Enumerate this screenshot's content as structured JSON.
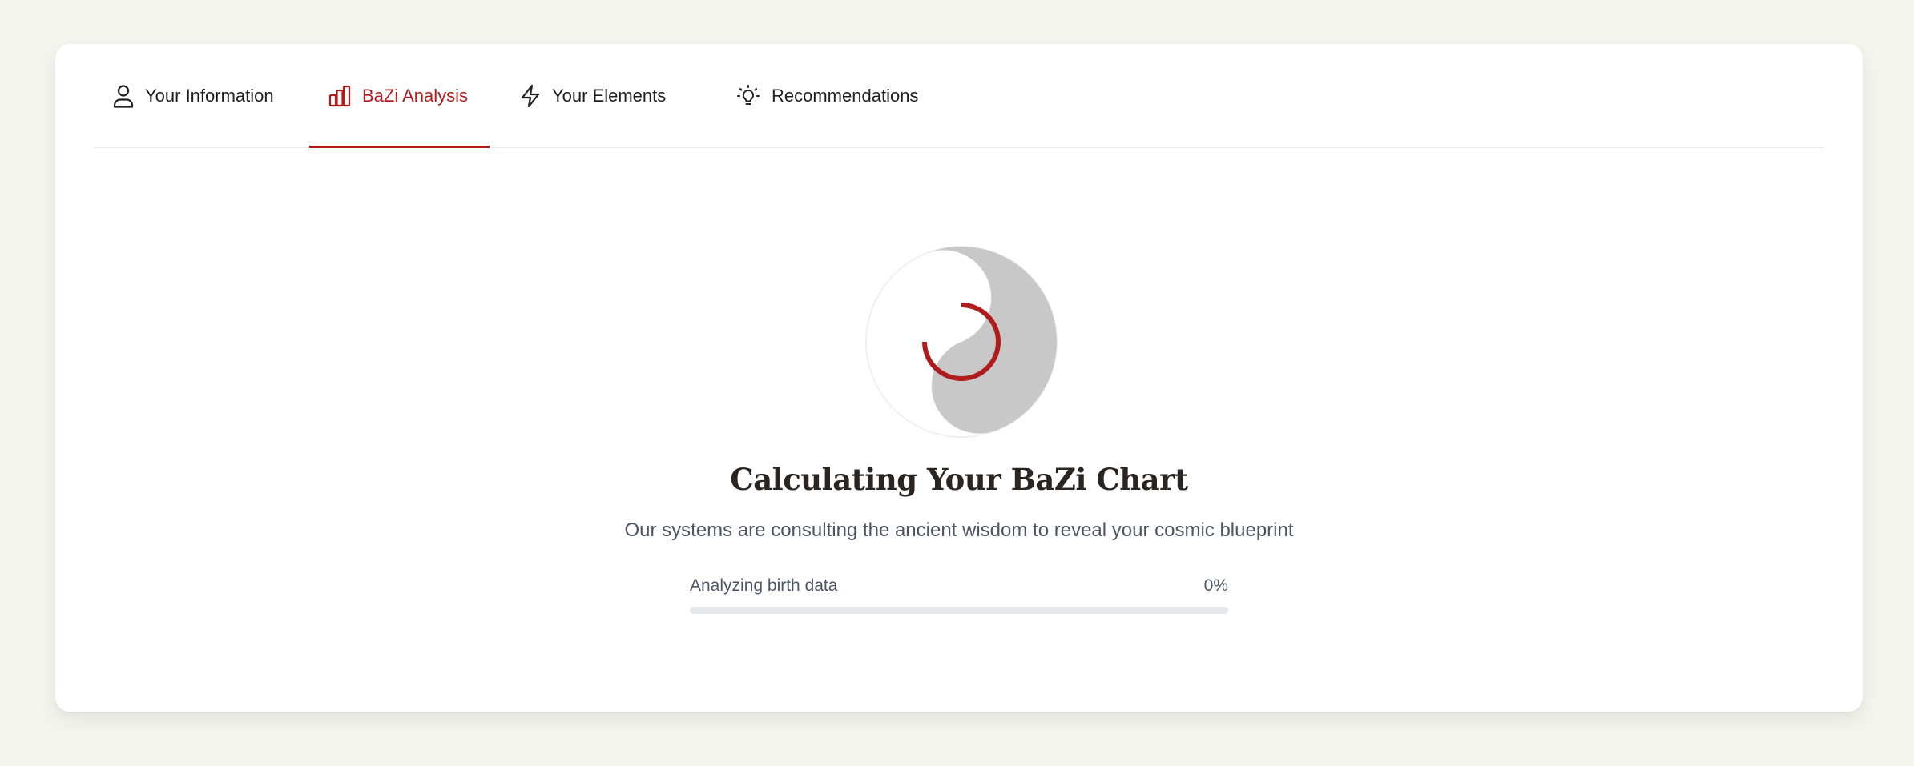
{
  "tabs": [
    {
      "label": "Your Information",
      "icon": "user-icon",
      "active": false
    },
    {
      "label": "BaZi Analysis",
      "icon": "bar-chart-icon",
      "active": true
    },
    {
      "label": "Your Elements",
      "icon": "lightning-icon",
      "active": false
    },
    {
      "label": "Recommendations",
      "icon": "lightbulb-icon",
      "active": false
    }
  ],
  "loading": {
    "title": "Calculating Your BaZi Chart",
    "subtitle": "Our systems are consulting the ancient wisdom to reveal your cosmic blueprint",
    "step_label": "Analyzing birth data",
    "percent_text": "0%",
    "progress_fraction": 0
  },
  "colors": {
    "accent": "#b01c1c",
    "text": "#1f1f1f",
    "muted": "#4b5563",
    "page_bg": "#f5f5f0",
    "yin_gray": "#c8c8c8"
  }
}
